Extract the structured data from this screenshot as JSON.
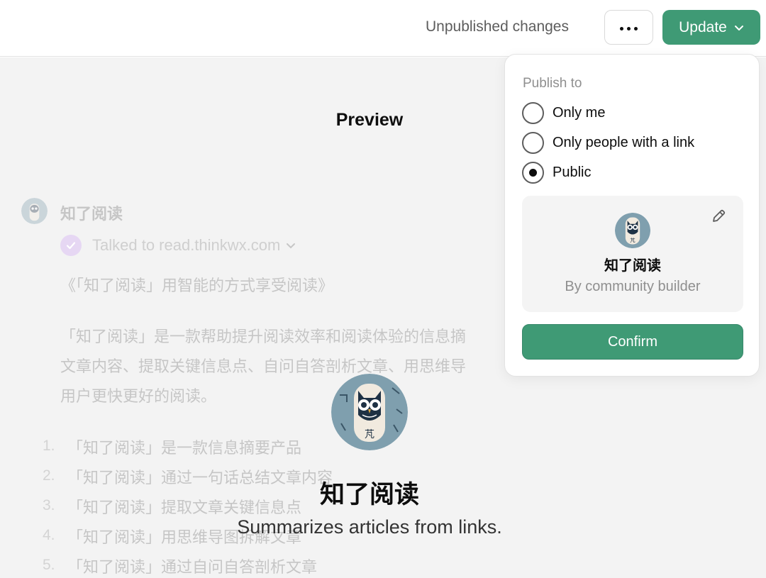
{
  "header": {
    "status": "Unpublished changes",
    "more_label": "More options",
    "update_label": "Update"
  },
  "preview": {
    "title": "Preview",
    "bot_name": "知了阅读",
    "talked_to": "Talked to read.thinkwx.com",
    "message_lines": [
      "《「知了阅读」用智能的方式享受阅读》",
      "「知了阅读」是一款帮助提升阅读效率和阅读体验的信息摘",
      "文章内容、提取关键信息点、自问自答剖析文章、用思维导",
      "用户更快更好的阅读。"
    ],
    "list_items": [
      {
        "num": "1.",
        "text": "「知了阅读」是一款信息摘要产品"
      },
      {
        "num": "2.",
        "text": "「知了阅读」通过一句话总结文章内容"
      },
      {
        "num": "3.",
        "text": "「知了阅读」提取文章关键信息点"
      },
      {
        "num": "4.",
        "text": "「知了阅读」用思维导图拆解文章"
      },
      {
        "num": "5.",
        "text": "「知了阅读」通过自问自答剖析文章"
      }
    ],
    "gpt_name": "知了阅读",
    "gpt_description": "Summarizes articles from links."
  },
  "publish": {
    "heading": "Publish to",
    "options": [
      {
        "label": "Only me",
        "selected": false
      },
      {
        "label": "Only people with a link",
        "selected": false
      },
      {
        "label": "Public",
        "selected": true
      }
    ],
    "card": {
      "name": "知了阅读",
      "byline": "By community builder"
    },
    "confirm_label": "Confirm"
  },
  "colors": {
    "accent": "#3f9a75",
    "avatar_bg": "#7f9fae",
    "owl_dark": "#1e3144"
  },
  "icons": {
    "more": "ellipsis-icon",
    "update_chevron": "chevron-down-icon",
    "talked_check": "check-icon",
    "edit": "pencil-icon",
    "avatar": "owl-icon"
  }
}
